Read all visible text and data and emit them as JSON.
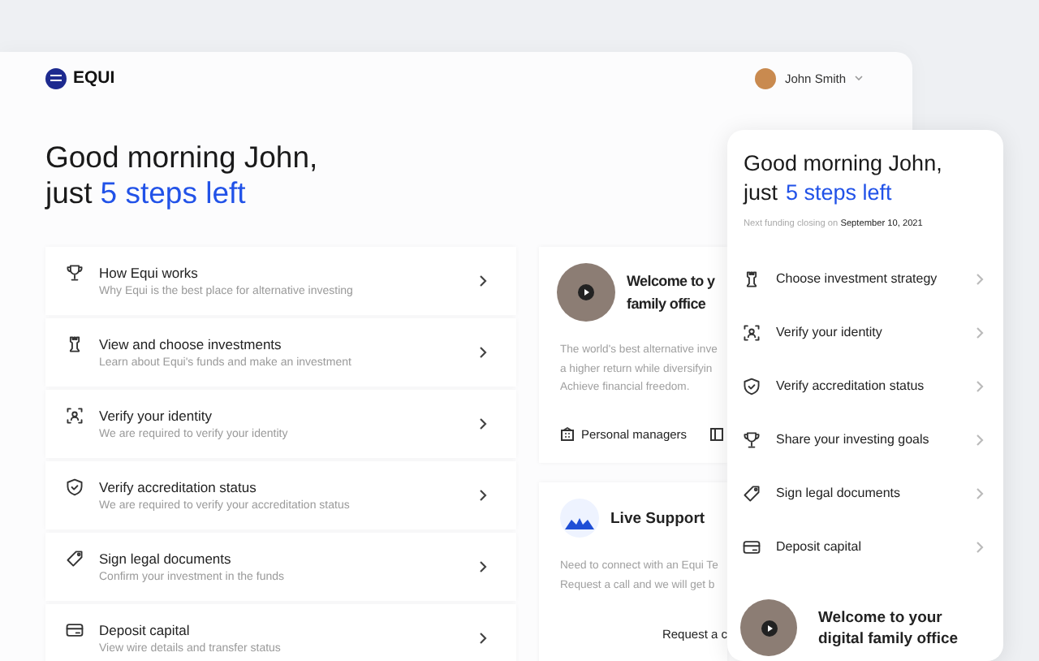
{
  "brand": {
    "name": "EQUI"
  },
  "user": {
    "name": "John Smith"
  },
  "greeting": {
    "line1": "Good morning John,",
    "prefix": "just",
    "highlight": "5 steps left"
  },
  "steps": [
    {
      "title": "How Equi works",
      "subtitle": "Why Equi is the best place for alternative investing"
    },
    {
      "title": "View and choose investments",
      "subtitle": "Learn about Equi's funds and make an investment"
    },
    {
      "title": "Verify your identity",
      "subtitle": "We are required to verify your identity"
    },
    {
      "title": "Verify accreditation status",
      "subtitle": "We are required to verify your accreditation status"
    },
    {
      "title": "Sign legal documents",
      "subtitle": "Confirm your investment in the funds"
    },
    {
      "title": "Deposit capital",
      "subtitle": "View wire details and transfer status"
    }
  ],
  "welcome_card": {
    "title_lines": [
      "Welcome to y",
      "family office"
    ],
    "description_lines": [
      "The world's best alternative inve",
      "a higher return while diversifyin",
      "Achieve financial freedom."
    ],
    "feature": "Personal managers"
  },
  "support_card": {
    "title": "Live Support",
    "description_lines": [
      "Need to connect with an Equi Te",
      "Request a call and we will get b"
    ],
    "action": "Request a c"
  },
  "mobile": {
    "line1": "Good morning John,",
    "prefix": "just",
    "highlight": "5 steps left",
    "funding_note": "Next funding closing on **September 10, 2021**",
    "steps": [
      "Choose investment strategy",
      "Verify your identity",
      "Verify accreditation status",
      "Share your investing goals",
      "Sign legal documents",
      "Deposit capital"
    ],
    "video_title": "Welcome to your digital family office"
  }
}
